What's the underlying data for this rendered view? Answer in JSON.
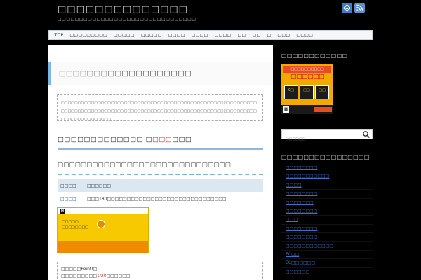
{
  "header": {
    "site_title": "□□□□□□□□□□□□□□",
    "site_description": "□□□□□□□□□□□□□□□□□□□□□□□□□□□□□□□□",
    "icons": [
      "feedly-icon",
      "rss-icon"
    ]
  },
  "nav": {
    "items": [
      "TOP",
      "□□□□□□□□□",
      "□□□□□",
      "□□□□□",
      "□□□□",
      "□□□□",
      "□□□□",
      "□□",
      "□□",
      "□",
      "□□□",
      "□□□□"
    ]
  },
  "post": {
    "title": "□□□□□□□□□□□□□□□□□□□",
    "intro": "□□□□□□□□□□□□□□□□□□□□□□□□□□□□□□□□□□□□□□□□□□□□□□□□□□□□□□□□□□□□□□□□□□□□□□□□□□□□□□□□□□□□□□□□□□□□□□□□□□□□□□□□□□□□□□□□□□□□□□□□□□□□□□□□□□□□□",
    "h2_main": "□□□□□□□□□□□□□ □",
    "h2_red": "□□□",
    "h2_tail": "□□□",
    "h3": "□□□□□□□□□□□□□□□□□□□□□□□□□□□□□□",
    "table": {
      "headers": [
        "□□□□",
        "□□□□□□"
      ],
      "row_name": "□□□□",
      "row_desc": "□□□180□□□□□□□□□□□□□□□□□□□□□□□□□□□□□□"
    },
    "point_label": "□□□□□Point!□",
    "point_prefix": "□□□□□□□□□",
    "point_red": "1/20",
    "point_suffix": "□□□□□□"
  },
  "banner": {
    "logo": "H",
    "line1": "□□□□□",
    "line2": "□□□□□□□□"
  },
  "sidebar": {
    "ad_title": "□□□□□□□□□□□□",
    "ad": {
      "top": "□□□□□□□□□□",
      "head": "□□□□□□",
      "tiles": [
        "0□",
        "□□",
        "□□"
      ],
      "logo": "H"
    },
    "search_placeholder": "□□□□□□",
    "categories_title": "□□□□□□□□□□□□□□□□",
    "categories": [
      "□□□□□□□□",
      "□□□□□□□□□□□",
      "□□□□",
      "□□□□□□□□",
      "□□□□□□□",
      "□□□□□□□□",
      "□□□",
      "□□□□□□□□",
      "□□□□□□□□",
      "□□□□□□□□□□□□",
      "EC□□",
      "EC□□□□□□",
      "□□□□□□"
    ]
  },
  "colors": {
    "accent_blue": "#7fb6e8",
    "red": "#d6332a",
    "link": "#1d56b8"
  }
}
